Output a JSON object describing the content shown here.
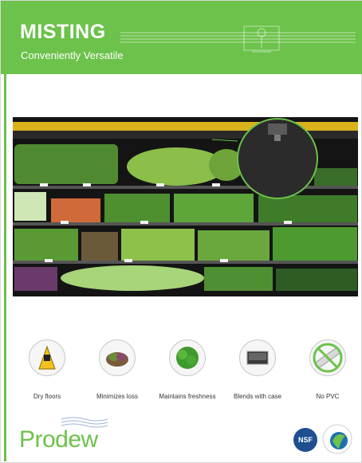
{
  "header": {
    "title": "MISTING",
    "subtitle": "Conveniently Versatile"
  },
  "features": [
    {
      "label": "Dry floors",
      "icon": "wet-floor-sign-icon"
    },
    {
      "label": "Minimizes loss",
      "icon": "lettuce-bowl-icon"
    },
    {
      "label": "Maintains freshness",
      "icon": "leafy-greens-icon"
    },
    {
      "label": "Blends with case",
      "icon": "case-panel-icon"
    },
    {
      "label": "No PVC",
      "icon": "no-pvc-tubing-icon"
    }
  ],
  "footer": {
    "brand": "Prodew",
    "nsf": "NSF",
    "seal": "green-seal-logo"
  },
  "colors": {
    "brand_green": "#6cc24a",
    "nsf_blue": "#1d4f91"
  }
}
